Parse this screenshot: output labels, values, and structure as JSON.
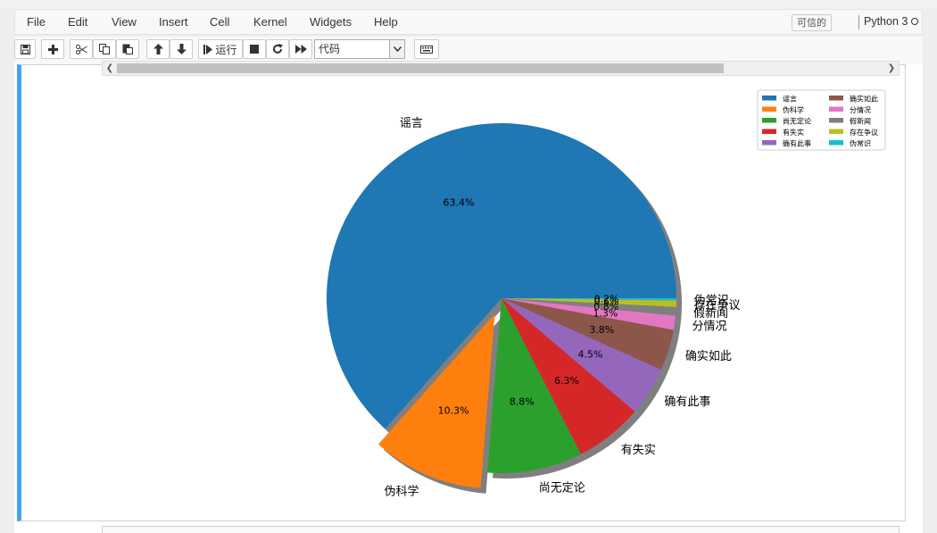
{
  "menubar": {
    "items": [
      "File",
      "Edit",
      "View",
      "Insert",
      "Cell",
      "Kernel",
      "Widgets",
      "Help"
    ],
    "trusted": "可信的",
    "kernel_name": "Python 3"
  },
  "toolbar": {
    "run_label": "运行",
    "cell_type": "代码"
  },
  "chart_data": {
    "type": "pie",
    "shadow": true,
    "exploded": [
      "伪科学"
    ],
    "start": "right, counterclockwise",
    "categories": [
      "谣言",
      "伪科学",
      "尚无定论",
      "有失实",
      "确有此事",
      "确实如此",
      "分情况",
      "假新闻",
      "存在争议",
      "伪常识"
    ],
    "values": [
      63.4,
      10.3,
      8.8,
      6.3,
      4.5,
      3.8,
      1.3,
      0.8,
      0.6,
      0.2
    ],
    "pct_labels": [
      "63.4%",
      "10.3%",
      "8.8%",
      "6.3%",
      "4.5%",
      "3.8%",
      "1.3%",
      "0.8%",
      "0.6%",
      "0.2%"
    ],
    "colors": [
      "#1f77b4",
      "#ff7f0e",
      "#2ca02c",
      "#d62728",
      "#9467bd",
      "#8c564b",
      "#e377c2",
      "#7f7f7f",
      "#bcbd22",
      "#17becf"
    ],
    "legend_position": "top-right",
    "legend_columns": 2
  }
}
